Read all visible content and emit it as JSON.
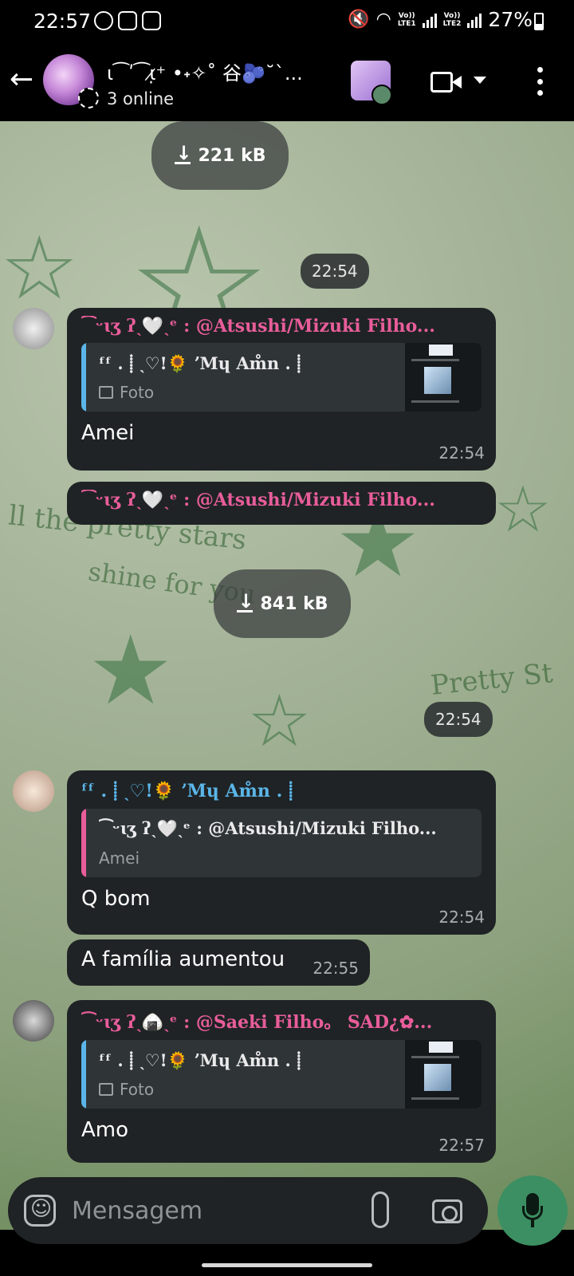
{
  "status_bar": {
    "time": "22:57",
    "battery": "27%",
    "lte1": "Vo)) LTE1",
    "lte2": "Vo)) LTE2"
  },
  "header": {
    "title": "ɩ⁀ʹ⁀ɩ̷̣⁺ •˖✧˚ 谷🫐˘ˋ...",
    "subtitle": "3 online"
  },
  "messages": {
    "file1_size": "221 kB",
    "time1": "22:54",
    "m1": {
      "sender": "⁀ᵕɩʒ ʔˎ🤍ˎᵉ : @Atsushi/Mizuki Filho...",
      "quote_name": "ᶠᶠ . ⸽ ˎ♡!🌻  ʼMɥ Am̊n . ⸽",
      "quote_sub": "Foto",
      "text": "Amei",
      "time": "22:54"
    },
    "m2_sender": "⁀ᵕɩʒ ʔˎ🤍ˎᵉ : @Atsushi/Mizuki Filho...",
    "file2_size": "841 kB",
    "time2": "22:54",
    "m3": {
      "sender": "ᶠᶠ . ⸽ ˎ♡!🌻  ʼMɥ Am̊n . ⸽",
      "quote_name": "⁀ᵕɩʒ ʔˎ🤍ˎᵉ : @Atsushi/Mizuki Filho...",
      "quote_sub": "Amei",
      "text": "Q bom",
      "time": "22:54"
    },
    "m4": {
      "text": "A família aumentou",
      "time": "22:55"
    },
    "m5": {
      "sender": "⁀ᵕɩʒ ʔˎ🍙ˎᵉ : @Saeki Filho。 SAD¿✿...",
      "quote_name": "ᶠᶠ . ⸽ ˎ♡!🌻  ʼMɥ Am̊n . ⸽",
      "quote_sub": "Foto",
      "text": "Amo",
      "time": "22:57"
    }
  },
  "composer": {
    "placeholder": "Mensagem"
  },
  "colors": {
    "sender_pink": "#e85d9a",
    "sender_blue": "#5bb5e8",
    "mic_green": "#3c8f62",
    "bubble": "#1f2325"
  }
}
